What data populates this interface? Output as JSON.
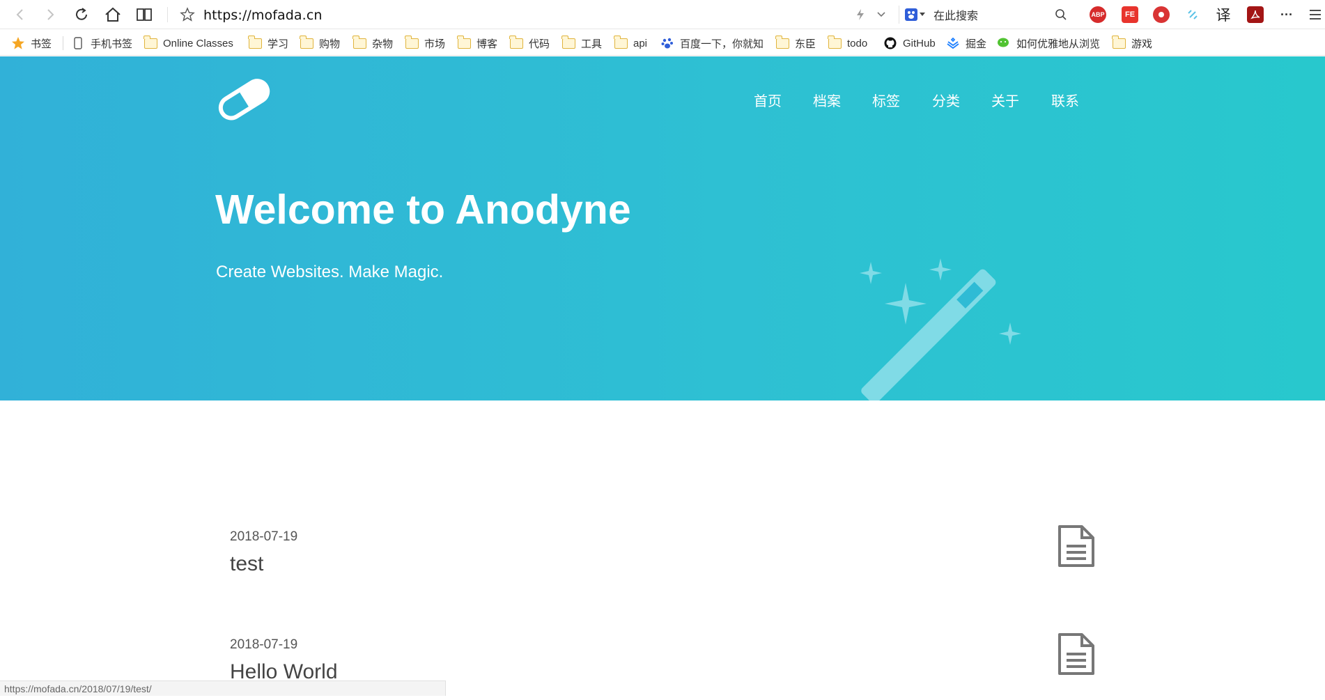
{
  "browser": {
    "url": "https://mofada.cn",
    "search_placeholder": "在此搜索",
    "translate_label": "译",
    "more_label": "···",
    "extensions": [
      "ABP",
      "FE"
    ]
  },
  "bookmarks": [
    {
      "label": "书签",
      "icon": "star-icon"
    },
    {
      "label": "手机书签",
      "icon": "phone-icon"
    },
    {
      "label": "Online Classes",
      "icon": "folder-icon"
    },
    {
      "label": "学习",
      "icon": "folder-icon"
    },
    {
      "label": "购物",
      "icon": "folder-icon"
    },
    {
      "label": "杂物",
      "icon": "folder-icon"
    },
    {
      "label": "市场",
      "icon": "folder-icon"
    },
    {
      "label": "博客",
      "icon": "folder-icon"
    },
    {
      "label": "代码",
      "icon": "folder-icon"
    },
    {
      "label": "工具",
      "icon": "folder-icon"
    },
    {
      "label": "api",
      "icon": "folder-icon"
    },
    {
      "label": "百度一下，你就知",
      "icon": "baidu-paw-icon"
    },
    {
      "label": "东臣",
      "icon": "folder-icon"
    },
    {
      "label": "todo",
      "icon": "folder-icon"
    },
    {
      "label": "GitHub",
      "icon": "github-icon"
    },
    {
      "label": "掘金",
      "icon": "juejin-icon"
    },
    {
      "label": "如何优雅地从浏览",
      "icon": "wechat-icon"
    },
    {
      "label": "游戏",
      "icon": "folder-icon"
    }
  ],
  "site": {
    "nav": [
      "首页",
      "档案",
      "标签",
      "分类",
      "关于",
      "联系"
    ],
    "hero_title": "Welcome to Anodyne",
    "hero_subtitle": "Create Websites. Make Magic."
  },
  "posts": [
    {
      "date": "2018-07-19",
      "title": "test"
    },
    {
      "date": "2018-07-19",
      "title": "Hello World"
    }
  ],
  "status_url": "https://mofada.cn/2018/07/19/test/",
  "colors": {
    "hero_start": "#31b1d8",
    "hero_end": "#28c8cd",
    "star_bookmark": "#f5a623"
  }
}
